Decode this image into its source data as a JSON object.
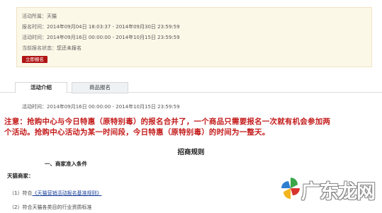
{
  "activity": {
    "owner_label": "活动所属：",
    "owner_value": "天猫",
    "signup_label": "报名时间：",
    "signup_value": "2014年09月04日 18:03:37 - 2014年09月30日 23:59:59",
    "active_label": "活动时间：",
    "active_value": "2014年09月16日 00:00:00 - 2014年10月15日 23:59:59",
    "status_label": "当前报名状态：",
    "status_value": "您还未报名",
    "apply_button": "立即报名"
  },
  "tabs": {
    "intro": "活动介绍",
    "goods": "商品报名"
  },
  "content": {
    "time_line": "活动时间：2014年09月16日 00:00:00 - 2014年10月15日 23:59:59",
    "notice_line1": "注意：抢购中心与今日特惠（原特别毒）的报名合并了，一个商品只需要报名一次就有机会参加两",
    "notice_line2": "个活动。抢购中心活动为某一时间段，今日特惠（原特别毒）的时间为一整天。",
    "rules_title": "招商规则",
    "section_title": "一、商家准入条件",
    "merchant_title": "天猫商家：",
    "item1_prefix": "（1）符合",
    "item1_link": "《天猫营销活动报名基准规则》",
    "item2": "（2）符合天猫各类目的行业资质标准"
  },
  "watermark": {
    "text": "广东龙网",
    "colors": {
      "green": "#3aa64a",
      "red": "#d9342b",
      "yellow": "#f2b51c",
      "blue": "#2f7fd0"
    }
  }
}
